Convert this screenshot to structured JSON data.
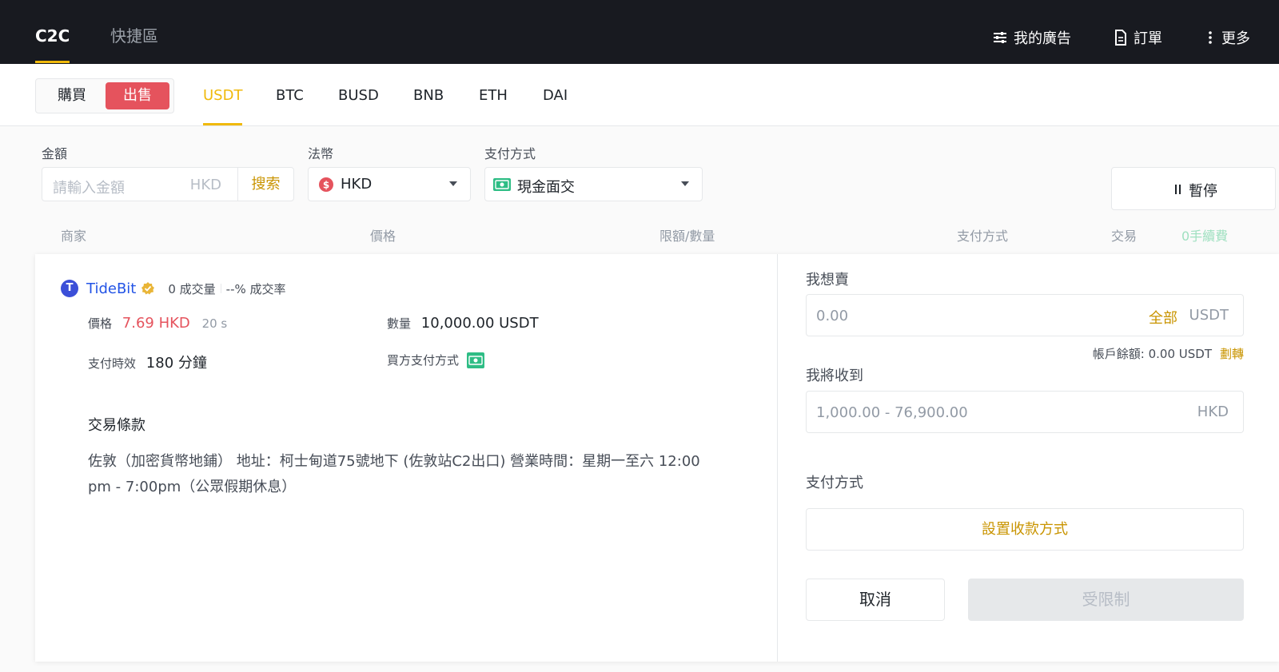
{
  "topbar": {
    "tabs": [
      "C2C",
      "快捷區"
    ],
    "right": [
      {
        "icon": "sliders-icon",
        "label": "我的廣告"
      },
      {
        "icon": "document-icon",
        "label": "訂單"
      },
      {
        "icon": "more-vertical-icon",
        "label": "更多"
      }
    ]
  },
  "subbar": {
    "buy_label": "購買",
    "sell_label": "出售",
    "coins": [
      "USDT",
      "BTC",
      "BUSD",
      "BNB",
      "ETH",
      "DAI"
    ],
    "active_coin": "USDT"
  },
  "filters": {
    "amount_label": "金額",
    "amount_placeholder": "請輸入金額",
    "amount_currency": "HKD",
    "search_label": "搜索",
    "fiat_label": "法幣",
    "fiat_value": "HKD",
    "payment_label": "支付方式",
    "payment_value": "現金面交",
    "pause_label": "暫停"
  },
  "table_header": {
    "merchant": "商家",
    "price": "價格",
    "limit": "限額/數量",
    "payment": "支付方式",
    "trade": "交易",
    "fee": "0手續費"
  },
  "ad": {
    "merchant_initial": "T",
    "merchant_name": "TideBit",
    "orders": "0 成交量",
    "completion": "--% 成交率",
    "price_label": "價格",
    "price_value": "7.69 HKD",
    "price_timer": "20 s",
    "quantity_label": "數量",
    "quantity_value": "10,000.00 USDT",
    "pay_time_label": "支付時效",
    "pay_time_value": "180 分鐘",
    "buyer_payment_label": "買方支付方式",
    "terms_title": "交易條款",
    "terms_body": "佐敦（加密貨幣地鋪） 地址：柯士甸道75號地下 (佐敦站C2出口) 營業時間：星期一至六 12:00 pm - 7:00pm（公眾假期休息）"
  },
  "form": {
    "sell_label": "我想賣",
    "sell_placeholder": "0.00",
    "all_label": "全部",
    "sell_unit": "USDT",
    "balance_text": "帳戶餘額: 0.00 USDT",
    "transfer_label": "劃轉",
    "receive_label": "我將收到",
    "receive_placeholder": "1,000.00 - 76,900.00",
    "receive_unit": "HKD",
    "payment_label": "支付方式",
    "set_payment_label": "設置收款方式",
    "cancel_label": "取消",
    "restricted_label": "受限制"
  },
  "colors": {
    "accent": "#f0b90b",
    "sell": "#e5535d",
    "cash_icon": "#2ebd85"
  }
}
